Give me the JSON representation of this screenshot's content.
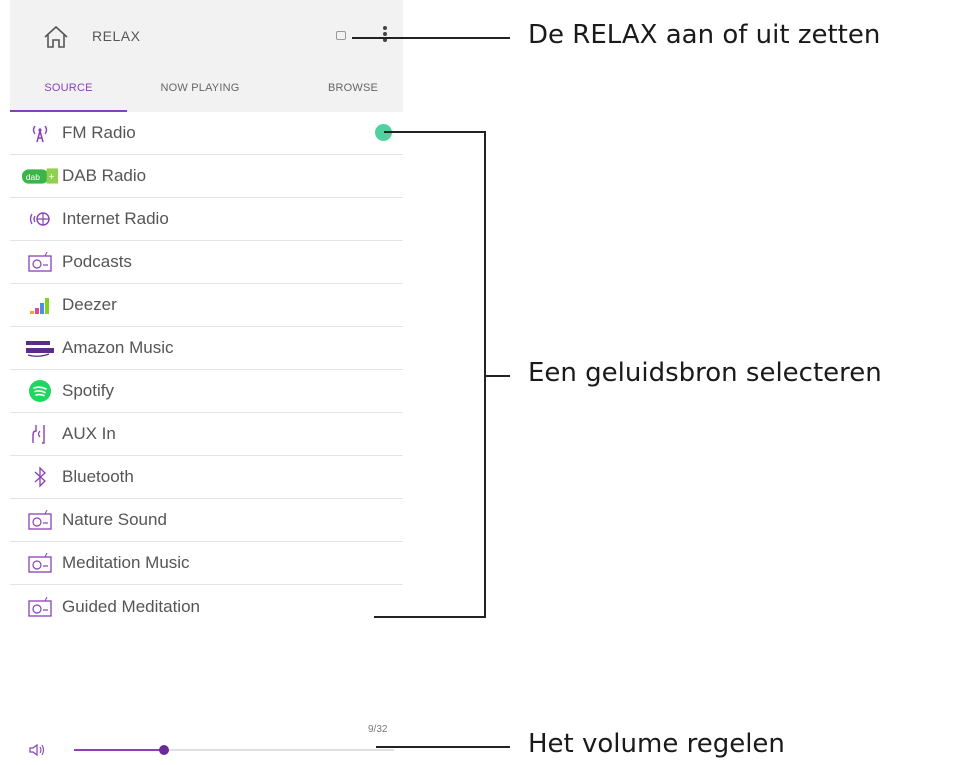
{
  "header": {
    "title": "RELAX",
    "icons": {
      "home": "home-icon",
      "power": "power-toggle",
      "menu": "more-vert-icon"
    }
  },
  "tabs": [
    {
      "label": "SOURCE",
      "active": true
    },
    {
      "label": "NOW PLAYING",
      "active": false
    },
    {
      "label": "BROWSE",
      "active": false
    }
  ],
  "sources": [
    {
      "label": "FM Radio",
      "icon": "fm-radio-icon",
      "active": true
    },
    {
      "label": "DAB Radio",
      "icon": "dab-radio-icon"
    },
    {
      "label": "Internet Radio",
      "icon": "internet-radio-icon"
    },
    {
      "label": "Podcasts",
      "icon": "podcasts-icon"
    },
    {
      "label": "Deezer",
      "icon": "deezer-icon"
    },
    {
      "label": "Amazon Music",
      "icon": "amazon-music-icon"
    },
    {
      "label": "Spotify",
      "icon": "spotify-icon"
    },
    {
      "label": "AUX In",
      "icon": "aux-in-icon"
    },
    {
      "label": "Bluetooth",
      "icon": "bluetooth-icon"
    },
    {
      "label": "Nature Sound",
      "icon": "nature-sound-icon"
    },
    {
      "label": "Meditation Music",
      "icon": "meditation-music-icon"
    },
    {
      "label": "Guided Meditation",
      "icon": "guided-meditation-icon"
    }
  ],
  "volume": {
    "current": 9,
    "max": 32,
    "display": "9/32",
    "icon": "speaker-icon"
  },
  "annotations": {
    "power": "De RELAX aan of uit zetten",
    "source": "Een geluidsbron selecteren",
    "volume": "Het volume regelen"
  },
  "colors": {
    "accent": "#8a3fb8",
    "active_dot": "#4fd1a0",
    "spotify": "#1ed760",
    "dab": "#3bb54a"
  }
}
